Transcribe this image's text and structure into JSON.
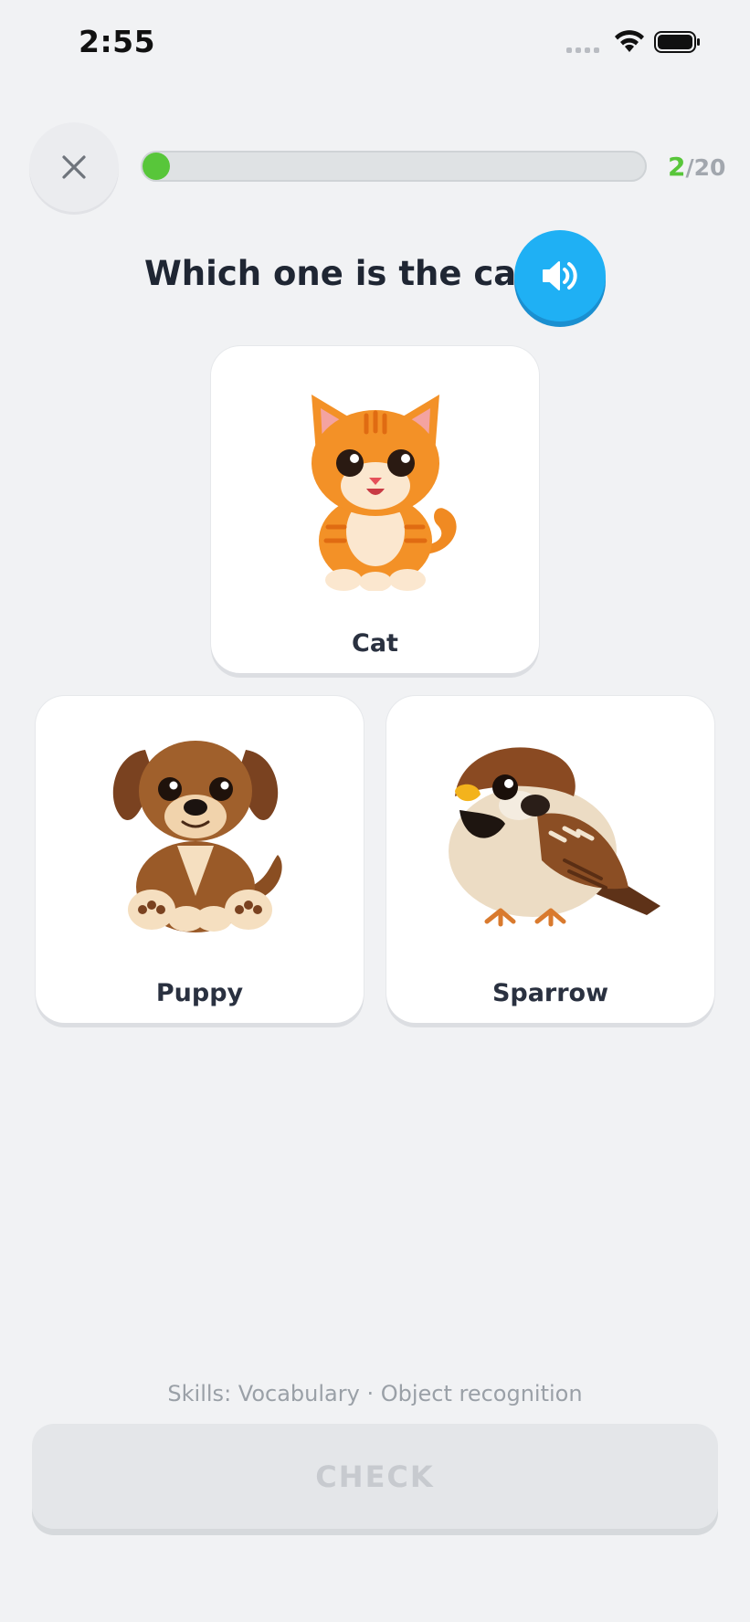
{
  "status_bar": {
    "time": "2:55"
  },
  "header": {
    "close_icon": "close-icon",
    "progress": {
      "current": "2",
      "total": "/20",
      "fraction": 0.1
    }
  },
  "question": {
    "text": "Which one is the cat?",
    "audio_icon": "speaker-icon"
  },
  "options": [
    {
      "label": "Cat",
      "image": "cat-illustration"
    },
    {
      "label": "Puppy",
      "image": "puppy-illustration"
    },
    {
      "label": "Sparrow",
      "image": "sparrow-illustration"
    }
  ],
  "footer": {
    "skills": "Skills: Vocabulary · Object recognition",
    "check_label": "CHECK"
  },
  "colors": {
    "accent_green": "#58c63a",
    "accent_blue": "#1fb0f4",
    "background": "#f1f2f4"
  }
}
